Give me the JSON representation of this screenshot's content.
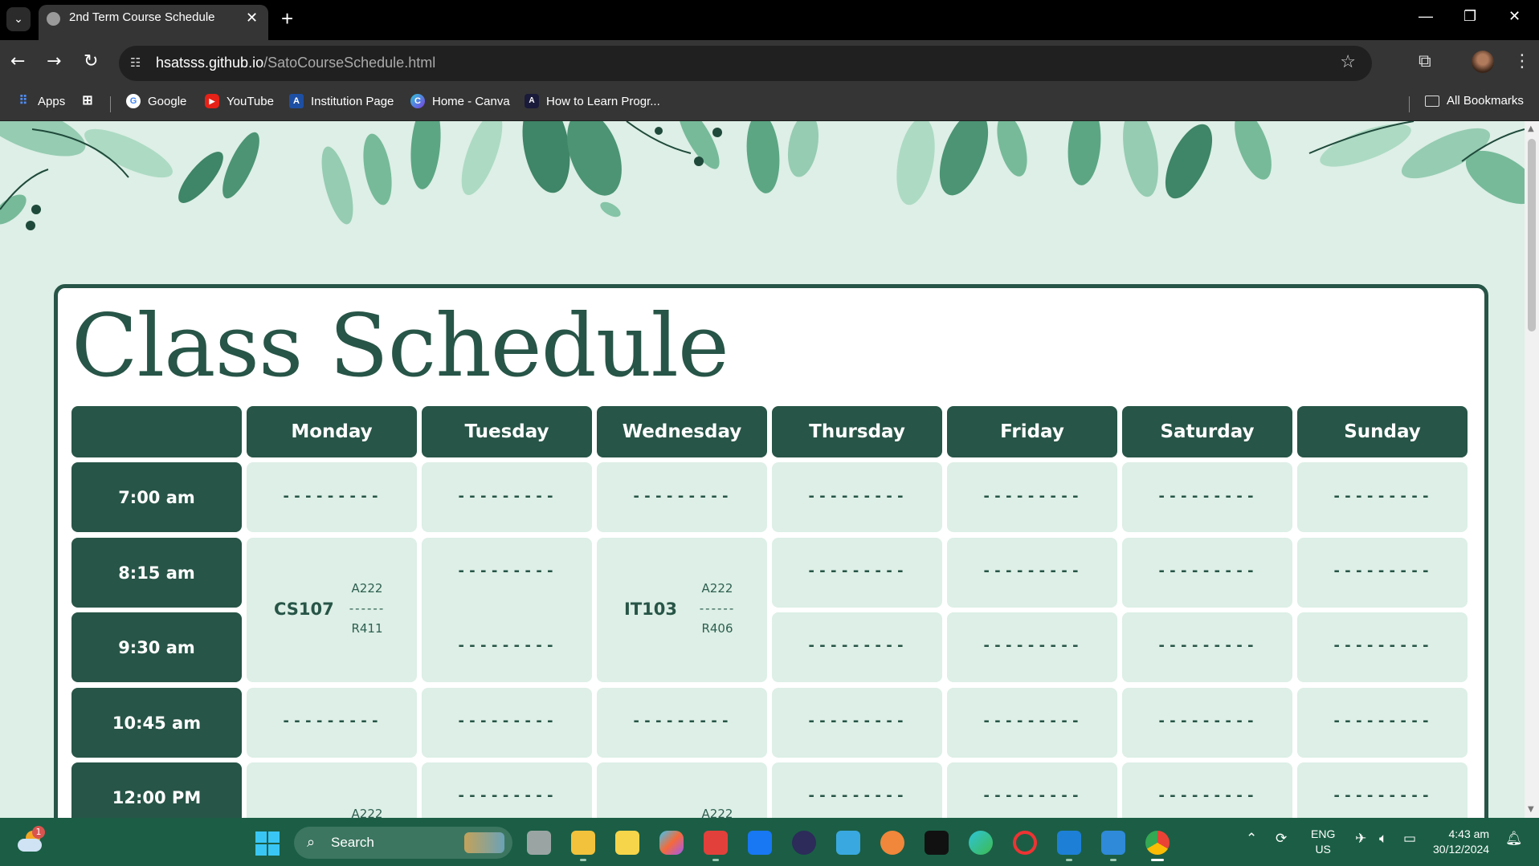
{
  "browser": {
    "tab_title": "2nd Term Course Schedule",
    "url_host": "hsatsss.github.io",
    "url_path": "/SatoCourseSchedule.html",
    "bookmarks": [
      "Apps",
      "Google",
      "YouTube",
      "Institution Page",
      "Home - Canva",
      "How to Learn Progr..."
    ],
    "all_bookmarks": "All Bookmarks"
  },
  "page": {
    "title": "Class Schedule",
    "days": [
      "Monday",
      "Tuesday",
      "Wednesday",
      "Thursday",
      "Friday",
      "Saturday",
      "Sunday"
    ],
    "times": [
      "7:00 am",
      "8:15 am",
      "9:30 am",
      "10:45 am",
      "12:00 PM"
    ],
    "empty_marker": "---------",
    "courses": [
      {
        "day": "Monday",
        "code": "CS107",
        "room_top": "A222",
        "separator": "------",
        "room_bottom": "R411"
      },
      {
        "day": "Wednesday",
        "code": "IT103",
        "room_top": "A222",
        "separator": "------",
        "room_bottom": "R406"
      }
    ],
    "partial_room_top": "A222",
    "colors": {
      "primary": "#275547",
      "cell": "#ddefe6",
      "background": "#ddefe6"
    }
  },
  "taskbar": {
    "search_placeholder": "Search",
    "weather_badge": "1",
    "language": "ENG",
    "region": "US",
    "time": "4:43 am",
    "date": "30/12/2024"
  }
}
